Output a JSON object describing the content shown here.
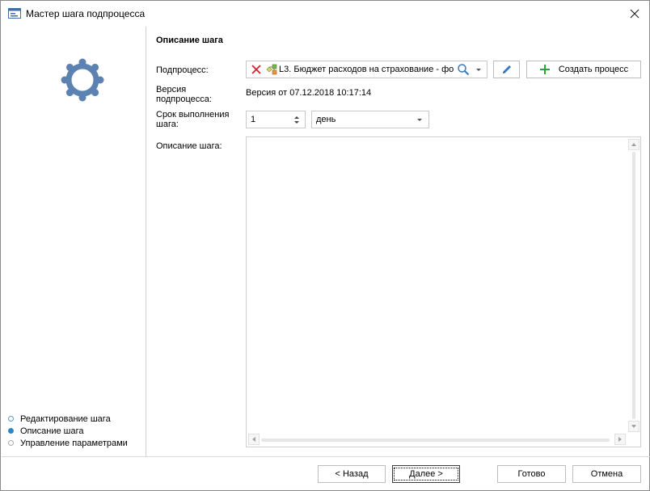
{
  "window": {
    "title": "Мастер шага подпроцесса"
  },
  "sidebar": {
    "steps": [
      {
        "label": "Редактирование шага",
        "state": "done"
      },
      {
        "label": "Описание шага",
        "state": "current"
      },
      {
        "label": "Управление параметрами",
        "state": "pending"
      }
    ]
  },
  "main": {
    "section_title": "Описание шага",
    "subprocess_label": "Подпроцесс:",
    "subprocess_value": "L3. Бюджет расходов на страхование - фо",
    "create_process_label": "Создать процесс",
    "version_label": "Версия подпроцесса:",
    "version_value": "Версия от 07.12.2018 10:17:14",
    "duration_label": "Срок выполнения шага:",
    "duration_value": "1",
    "duration_unit": "день",
    "description_label": "Описание шага:",
    "description_value": ""
  },
  "footer": {
    "back_label": "< Назад",
    "next_label": "Далее >",
    "done_label": "Готово",
    "cancel_label": "Отмена"
  },
  "colors": {
    "accent": "#2b86c5",
    "gear": "#5b82b0",
    "plus": "#2aa43a",
    "clear": "#d6202a"
  }
}
